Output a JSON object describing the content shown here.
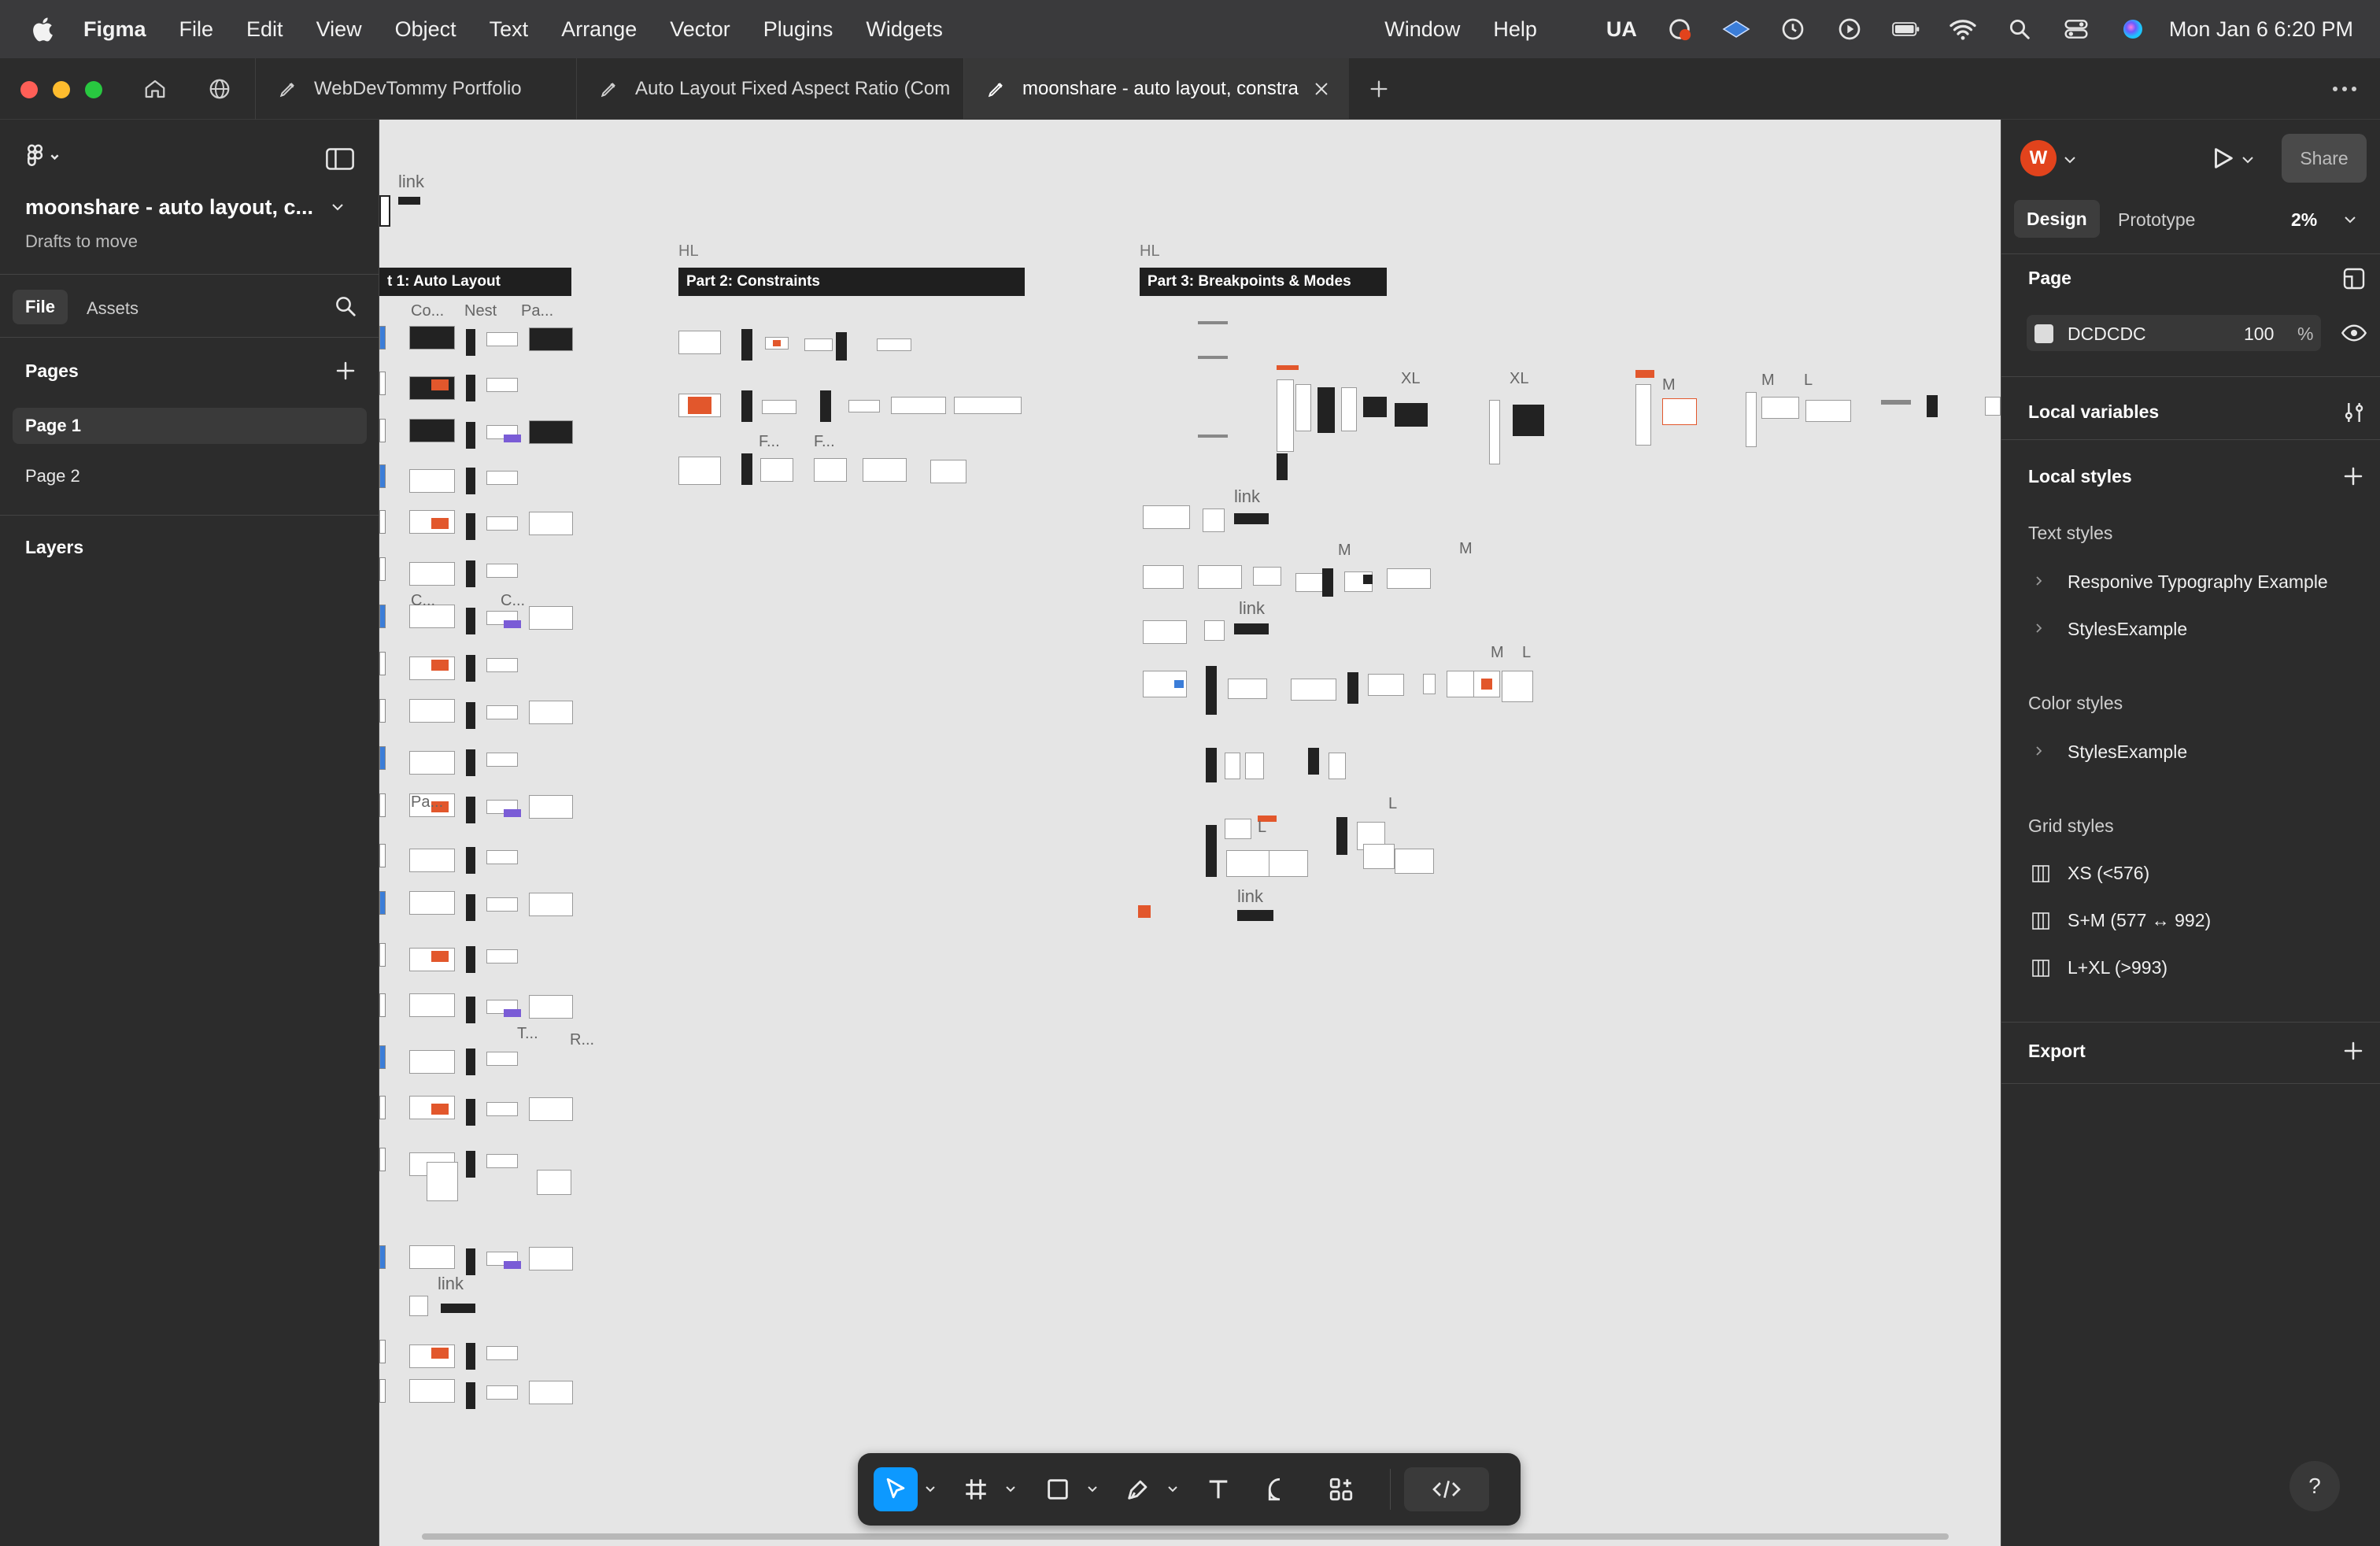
{
  "menubar": {
    "app": "Figma",
    "items": [
      "File",
      "Edit",
      "View",
      "Object",
      "Text",
      "Arrange",
      "Vector",
      "Plugins",
      "Widgets"
    ],
    "right_items": [
      "Window",
      "Help"
    ],
    "input_source": "UA",
    "datetime": "Mon Jan 6  6:20 PM"
  },
  "tabs": [
    {
      "label": "WebDevTommy Portfolio"
    },
    {
      "label": "Auto Layout Fixed Aspect Ratio (Com"
    },
    {
      "label": "moonshare - auto layout, constra"
    }
  ],
  "left_panel": {
    "file_name": "moonshare - auto layout, c...",
    "project": "Drafts to move",
    "tab_file": "File",
    "tab_assets": "Assets",
    "pages_title": "Pages",
    "pages": [
      "Page 1",
      "Page 2"
    ],
    "layers_title": "Layers"
  },
  "canvas": {
    "hl": "HL",
    "sections": {
      "part1": "t 1: Auto Layout",
      "part2": "Part 2: Constraints",
      "part3": "Part 3: Breakpoints & Modes"
    },
    "labels": {
      "link": "link",
      "co": "Co...",
      "nest": "Nest",
      "pa": "Pa...",
      "c": "C...",
      "f": "F...",
      "m": "M",
      "l": "L",
      "xl": "XL",
      "t": "T...",
      "r": "R..."
    }
  },
  "right_panel": {
    "avatar_initial": "W",
    "share": "Share",
    "tab_design": "Design",
    "tab_prototype": "Prototype",
    "zoom": "2%",
    "page_title": "Page",
    "page_color": "DCDCDC",
    "page_opacity": "100",
    "percent": "%",
    "local_variables": "Local variables",
    "local_styles": "Local styles",
    "text_styles_title": "Text styles",
    "text_styles": [
      "Responive Typography Example",
      "StylesExample"
    ],
    "color_styles_title": "Color styles",
    "color_styles": [
      "StylesExample"
    ],
    "grid_styles_title": "Grid styles",
    "grid_styles": [
      "XS (<576)",
      "S+M (577 ↔ 992)",
      "L+XL (>993)"
    ],
    "export": "Export"
  },
  "help": "?",
  "colors": {
    "accent": "#0d99ff",
    "avatar": "#e2431c",
    "canvas": "#e5e5e5",
    "panel": "#2c2c2c"
  }
}
